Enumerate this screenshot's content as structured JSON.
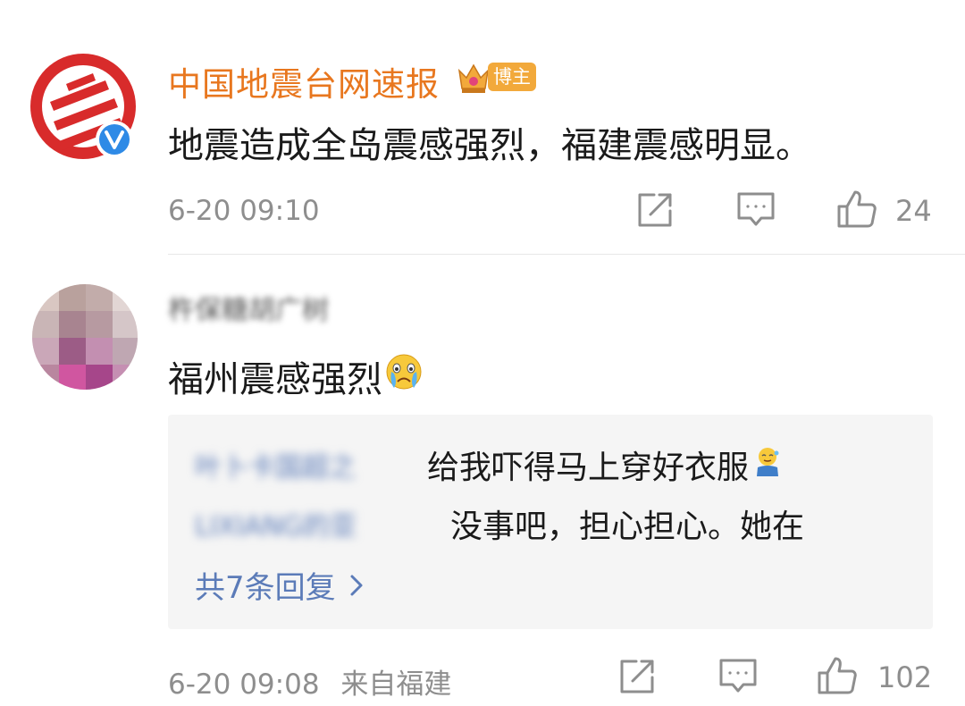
{
  "post": {
    "author": "中国地震台网速报",
    "badge_label": "博主",
    "content": "地震造成全岛震感强烈，福建震感明显。",
    "time": "6-20 09:10",
    "like_count": "24"
  },
  "comment": {
    "author": "杵保糖胡广树",
    "content": "福州震感强烈",
    "time": "6-20 09:08",
    "location": "来自福建",
    "like_count": "102",
    "replies": [
      {
        "author": "叶卜卡国超之",
        "text": "给我吓得马上穿好衣服"
      },
      {
        "author": "LIXIANG的亚",
        "text": "没事吧，担心担心。她在"
      }
    ],
    "more_replies": "共7条回复"
  },
  "icons": [
    "share-icon",
    "comment-icon",
    "like-icon",
    "verified-icon",
    "crown-icon",
    "crying-emoji-icon",
    "sweat-emoji-icon",
    "chevron-right-icon"
  ],
  "colors": {
    "author": "#e8771f",
    "link": "#5b7bb8",
    "meta": "#8e8e8e",
    "verified": "#2e8ae6",
    "logo_red": "#d82b2b"
  }
}
